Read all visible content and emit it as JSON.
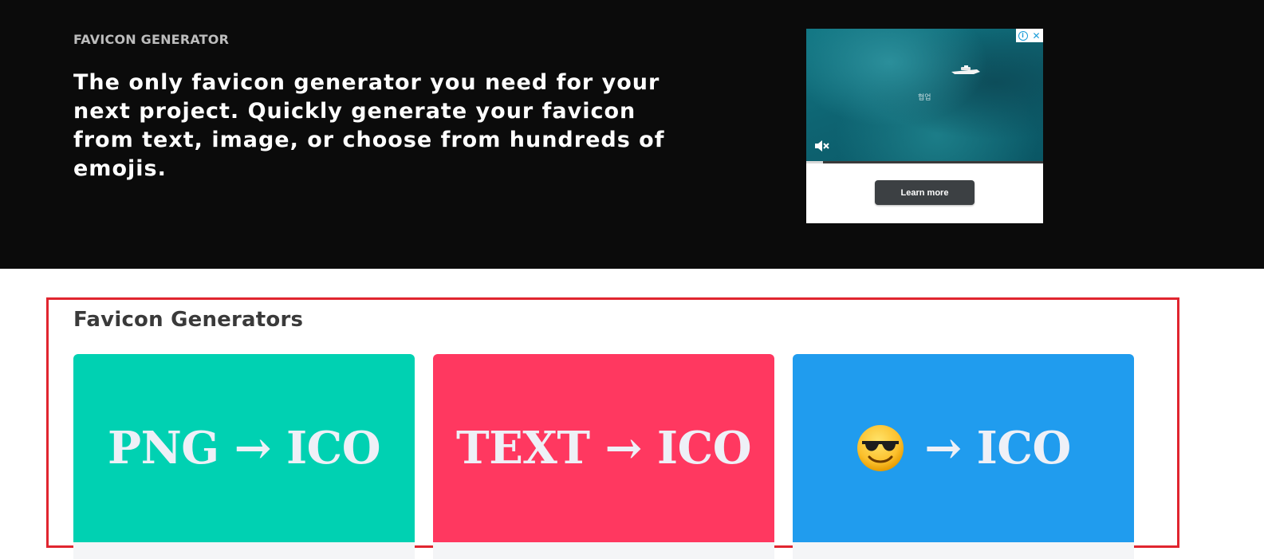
{
  "hero": {
    "eyebrow": "FAVICON GENERATOR",
    "tagline": "The only favicon generator you need for your next project. Quickly generate your favicon from text, image, or choose from hundreds of emojis."
  },
  "ad": {
    "watermark": "협업",
    "cta_label": "Learn more",
    "progress": 0.07,
    "icons": [
      "info-icon",
      "close-icon",
      "mute-icon"
    ]
  },
  "section": {
    "title": "Favicon Generators",
    "highlight_color": "#e0252f"
  },
  "cards": [
    {
      "label": "PNG → ICO",
      "color": "#00d1b2"
    },
    {
      "label": "TEXT → ICO",
      "color": "#ff3860"
    },
    {
      "emoji": "sunglasses-face-icon",
      "label": "→ ICO",
      "color": "#209cee"
    }
  ]
}
